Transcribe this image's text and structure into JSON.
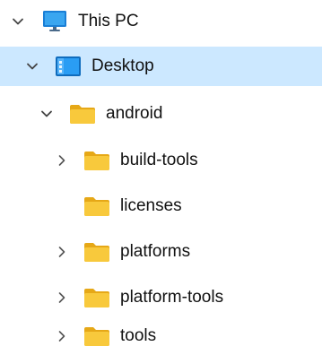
{
  "nav_tree": {
    "items": [
      {
        "label": "This PC",
        "icon": "computer-icon",
        "expand": "expanded",
        "selected": false
      },
      {
        "label": "Desktop",
        "icon": "desktop-icon",
        "expand": "expanded",
        "selected": true
      },
      {
        "label": "android",
        "icon": "folder-icon",
        "expand": "expanded",
        "selected": false
      },
      {
        "label": "build-tools",
        "icon": "folder-icon",
        "expand": "collapsed",
        "selected": false
      },
      {
        "label": "licenses",
        "icon": "folder-icon",
        "expand": "none",
        "selected": false
      },
      {
        "label": "platforms",
        "icon": "folder-icon",
        "expand": "collapsed",
        "selected": false
      },
      {
        "label": "platform-tools",
        "icon": "folder-icon",
        "expand": "collapsed",
        "selected": false
      },
      {
        "label": "tools",
        "icon": "folder-icon",
        "expand": "collapsed",
        "selected": false
      }
    ]
  },
  "colors": {
    "selection": "#cce8ff",
    "folder": "#f8c93c",
    "folder_dark": "#e6a817",
    "monitor": "#1e90e8",
    "chevron": "#555555"
  }
}
